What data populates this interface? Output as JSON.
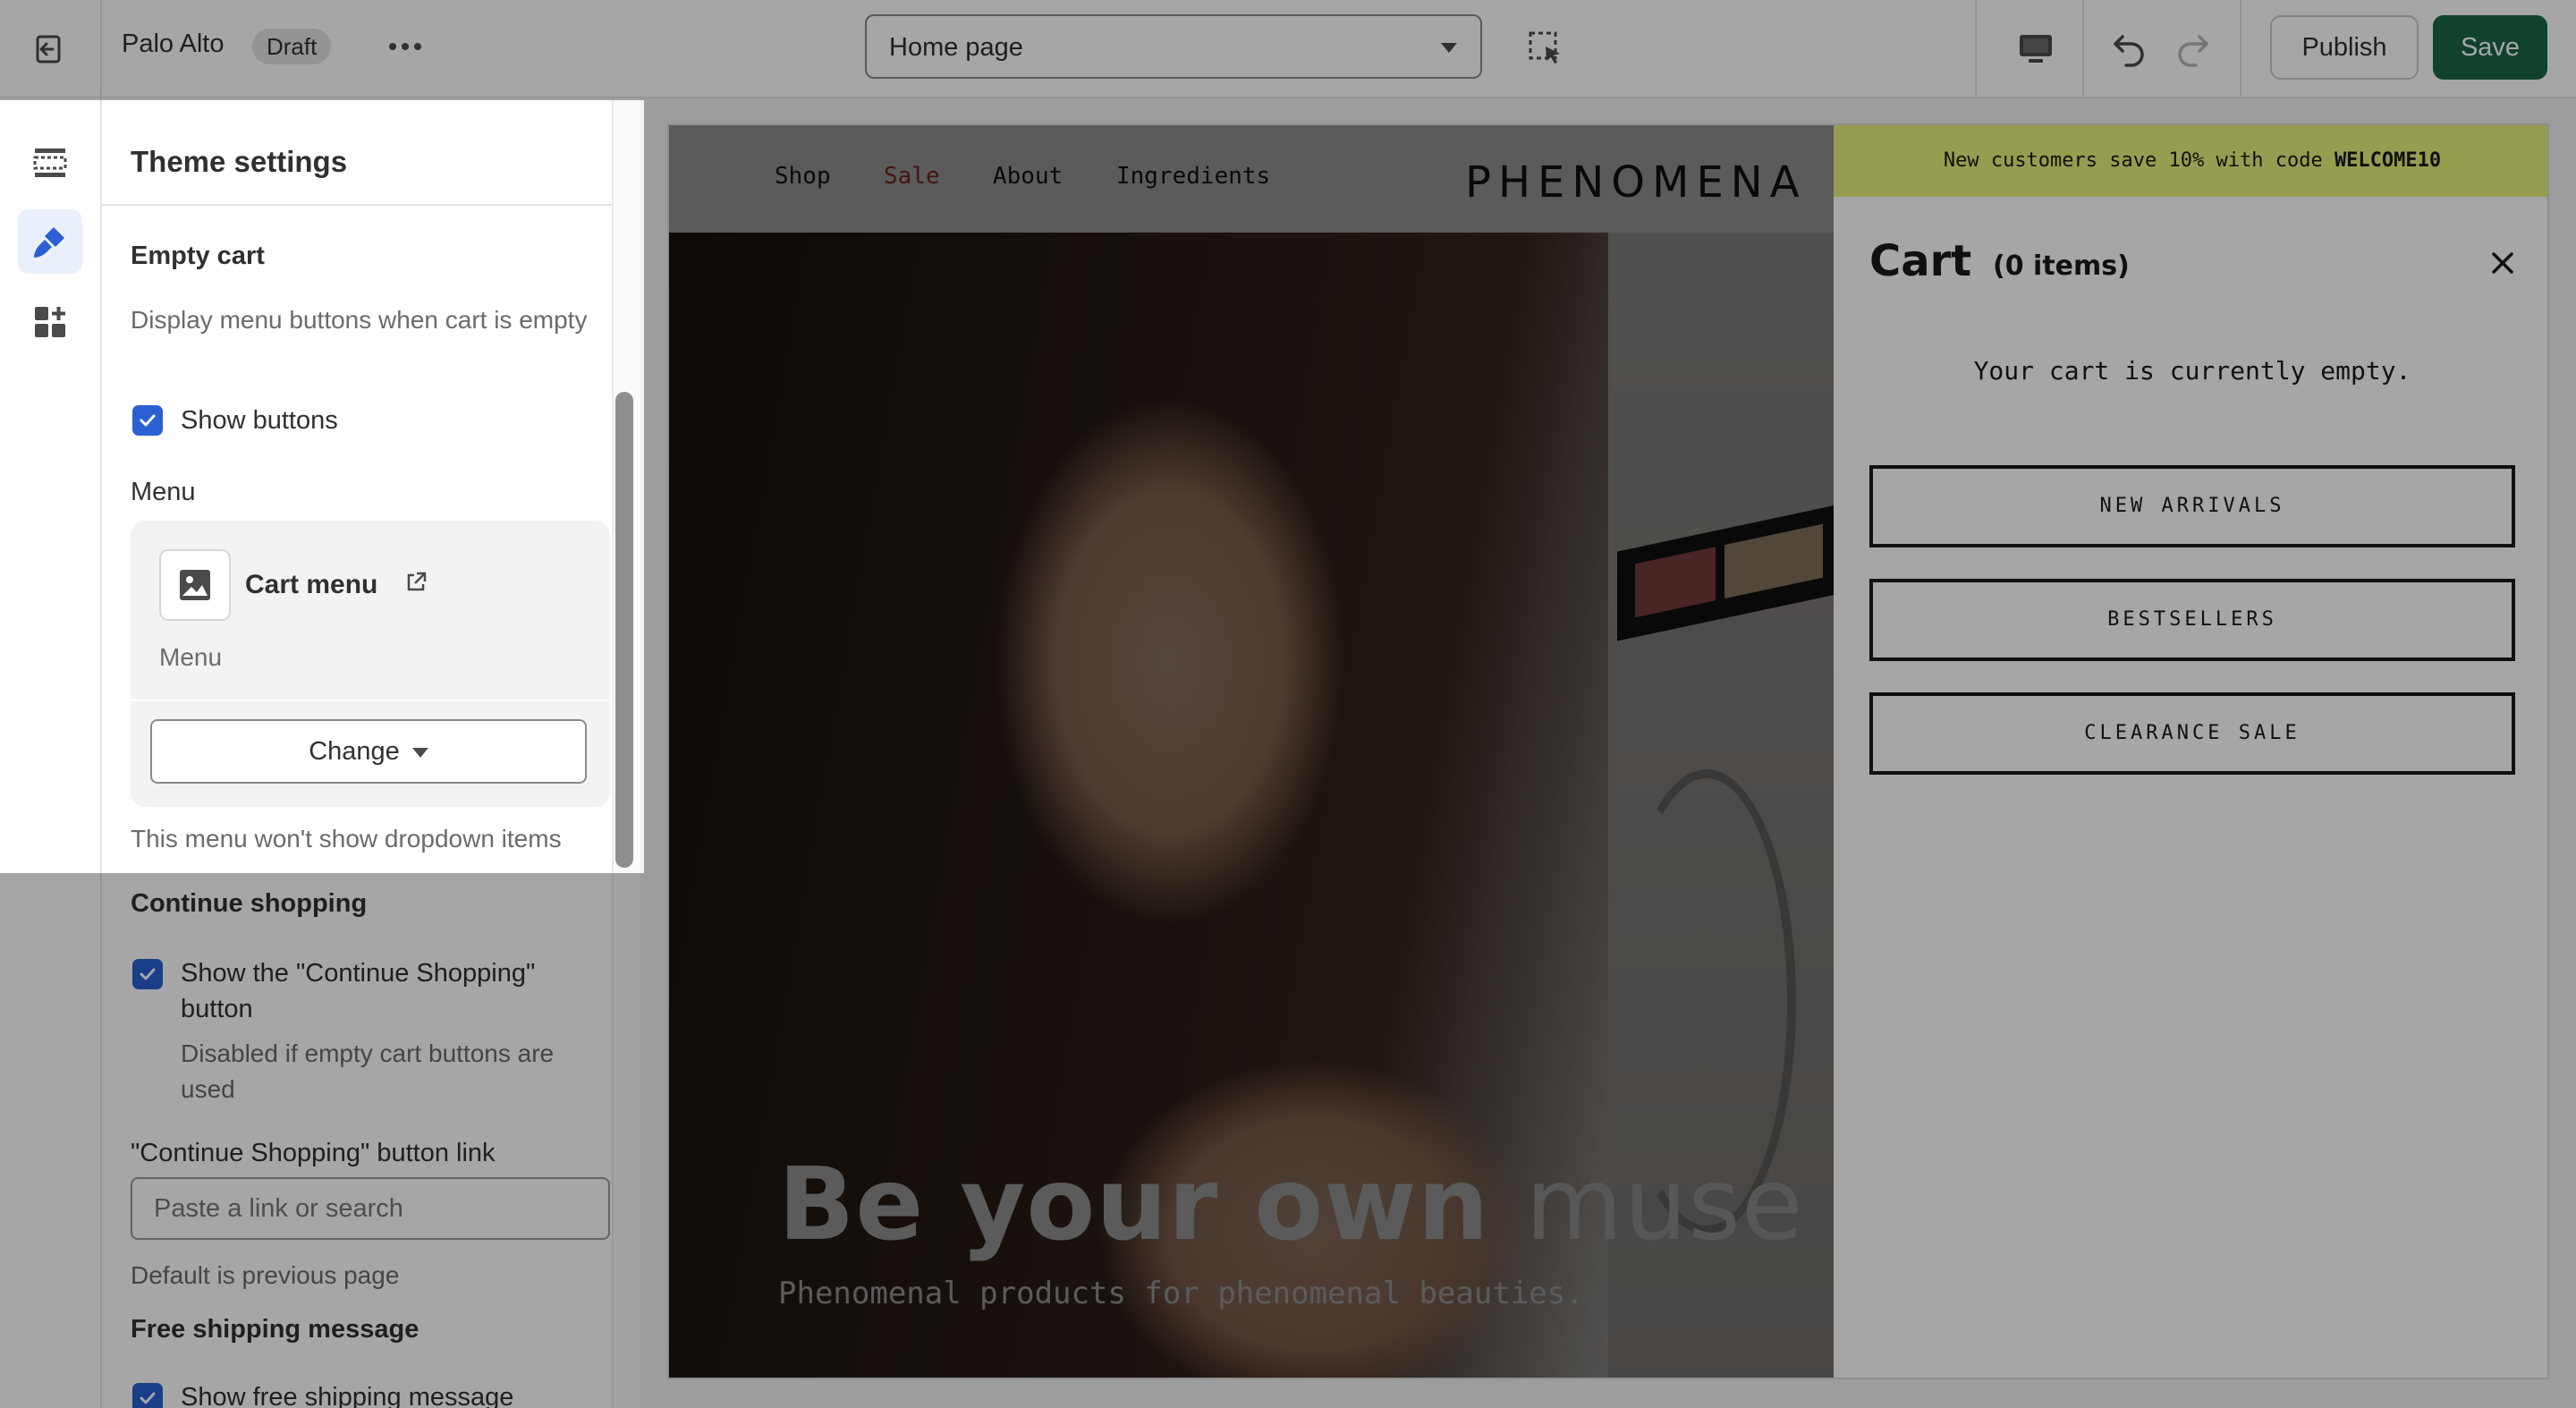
{
  "topbar": {
    "store_name": "Palo Alto",
    "status_badge": "Draft",
    "page_selector": "Home page",
    "publish_label": "Publish",
    "save_label": "Save"
  },
  "icon_rail": {
    "items": [
      {
        "icon": "sections-icon",
        "active": false
      },
      {
        "icon": "theme-settings-paintbrush-icon",
        "active": true
      },
      {
        "icon": "apps-add-icon",
        "active": false
      }
    ]
  },
  "settings": {
    "title": "Theme settings",
    "empty_cart": {
      "heading": "Empty cart",
      "description": "Display menu buttons when cart is empty",
      "show_buttons_label": "Show buttons",
      "show_buttons_checked": true,
      "menu_label": "Menu",
      "menu_card": {
        "name": "Cart menu",
        "type": "Menu",
        "change_label": "Change"
      },
      "menu_help": "This menu won't show dropdown items"
    },
    "continue_shopping": {
      "heading": "Continue shopping",
      "checkbox_label_line1": "Show the \"Continue Shopping\"",
      "checkbox_label_line2": "button",
      "checkbox_checked": true,
      "checkbox_help_line1": "Disabled if empty cart buttons are",
      "checkbox_help_line2": "used",
      "link_label": "\"Continue Shopping\" button link",
      "link_placeholder": "Paste a link or search",
      "link_help": "Default is previous page"
    },
    "free_shipping": {
      "heading": "Free shipping message",
      "checkbox_label": "Show free shipping message",
      "checkbox_checked": true
    }
  },
  "preview": {
    "nav": [
      "Shop",
      "Sale",
      "About",
      "Ingredients"
    ],
    "logo": "PHENOMENA",
    "hero_title_bold": "Be your own",
    "hero_title_light": "muse",
    "hero_subtitle": "Phenomenal products for phenomenal beauties.",
    "announcement_prefix": "New customers save 10% with code",
    "announcement_code": "WELCOME10",
    "cart": {
      "title": "Cart",
      "count": "(0 items)",
      "empty_message": "Your cart is currently empty.",
      "buttons": [
        "NEW ARRIVALS",
        "BESTSELLERS",
        "CLEARANCE SALE"
      ]
    }
  },
  "colors": {
    "save_button": "#1b6648",
    "checkbox": "#2a60d4",
    "announcement_bar": "#e7f17b",
    "sale_link": "#c0392b"
  }
}
